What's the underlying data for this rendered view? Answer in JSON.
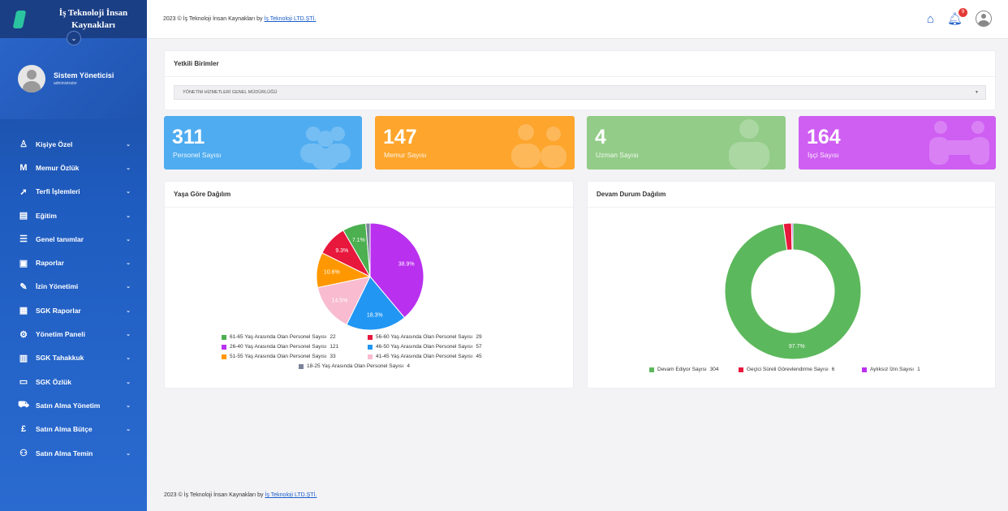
{
  "app": {
    "title": "İş Teknoloji İnsan Kaynakları",
    "user_name": "Sistem Yöneticisi",
    "user_role": "administrator"
  },
  "sidebar": {
    "items": [
      {
        "label": "Kişiye Özel",
        "icon": "user-icon",
        "glyph": "♙"
      },
      {
        "label": "Memur Özlük",
        "icon": "m-icon",
        "glyph": "M"
      },
      {
        "label": "Terfi İşlemleri",
        "icon": "rocket-icon",
        "glyph": "➚"
      },
      {
        "label": "Eğitim",
        "icon": "chalkboard-icon",
        "glyph": "▤"
      },
      {
        "label": "Genel tanımlar",
        "icon": "list-icon",
        "glyph": "☰"
      },
      {
        "label": "Raporlar",
        "icon": "document-icon",
        "glyph": "▣"
      },
      {
        "label": "İzin Yönetimi",
        "icon": "pen-icon",
        "glyph": "✎"
      },
      {
        "label": "SGK Raporlar",
        "icon": "calendar-icon",
        "glyph": "▦"
      },
      {
        "label": "Yönetim Paneli",
        "icon": "gear-icon",
        "glyph": "⚙"
      },
      {
        "label": "SGK Tahakkuk",
        "icon": "building-icon",
        "glyph": "▥"
      },
      {
        "label": "SGK Özlük",
        "icon": "idcard-icon",
        "glyph": "▭"
      },
      {
        "label": "Satın Alma Yönetim",
        "icon": "cart-icon",
        "glyph": "⛟"
      },
      {
        "label": "Satın Alma Bütçe",
        "icon": "pound-icon",
        "glyph": "£"
      },
      {
        "label": "Satın Alma Temin",
        "icon": "people-icon",
        "glyph": "⚇"
      }
    ]
  },
  "topbar": {
    "copyright_prefix": "2023 © İş Teknoloji İnsan Kaynakları by ",
    "copyright_link": "İş Teknoloji LTD.ŞTİ.",
    "notification_count": "9"
  },
  "units": {
    "title": "Yetkili Birimler",
    "selected": "YÖNETİM HİZMETLERİ GENEL MÜDÜRLÜĞÜ"
  },
  "stats": [
    {
      "value": "311",
      "label": "Personel Sayısı",
      "color": "#4facf0",
      "icon": "group-icon"
    },
    {
      "value": "147",
      "label": "Memur Sayısı",
      "color": "#fda52c",
      "icon": "group-icon"
    },
    {
      "value": "4",
      "label": "Uzman Sayısı",
      "color": "#93cc88",
      "icon": "person-tie-icon"
    },
    {
      "value": "164",
      "label": "İşçi Sayısı",
      "color": "#cf5ef2",
      "icon": "worker-icon"
    }
  ],
  "age_chart": {
    "title": "Yaşa Göre Dağılım"
  },
  "status_chart": {
    "title": "Devam Durum Dağılım"
  },
  "chart_data": [
    {
      "type": "pie",
      "title": "Yaşa Göre Dağılım",
      "slices": [
        {
          "label": "61-65 Yaş Arasında Olan Personel Sayısı",
          "value": 22,
          "color": "#4caf50",
          "pct_label": "7.1%"
        },
        {
          "label": "56-60 Yaş Arasında Olan Personel Sayısı",
          "value": 29,
          "color": "#e8173c",
          "pct_label": "9.3%"
        },
        {
          "label": "26-40 Yaş Arasında Olan Personel Sayısı",
          "value": 121,
          "color": "#b930ef",
          "pct_label": "38.9%"
        },
        {
          "label": "46-50 Yaş Arasında Olan Personel Sayısı",
          "value": 57,
          "color": "#2196f3",
          "pct_label": "18.3%"
        },
        {
          "label": "51-55 Yaş Arasında Olan Personel Sayısı",
          "value": 33,
          "color": "#ff9800",
          "pct_label": "10.6%"
        },
        {
          "label": "41-45 Yaş Arasında Olan Personel Sayısı",
          "value": 45,
          "color": "#f8bbd0",
          "pct_label": "14.5%"
        },
        {
          "label": "18-25 Yaş Arasında Olan Personel Sayısı",
          "value": 4,
          "color": "#7a8399",
          "pct_label": ""
        }
      ],
      "draw_order": [
        2,
        3,
        5,
        4,
        1,
        0,
        6
      ]
    },
    {
      "type": "pie",
      "title": "Devam Durum Dağılım",
      "donut": true,
      "slices": [
        {
          "label": "Devam Ediyor Sayısı",
          "value": 304,
          "color": "#5cb85c",
          "pct_label": "97.7%"
        },
        {
          "label": "Geçici Süreli Görevlendirme Sayısı",
          "value": 6,
          "color": "#e8173c",
          "pct_label": ""
        },
        {
          "label": "Aylıksız İzin Sayısı",
          "value": 1,
          "color": "#b930ef",
          "pct_label": ""
        }
      ],
      "draw_order": [
        0,
        1,
        2
      ]
    }
  ]
}
